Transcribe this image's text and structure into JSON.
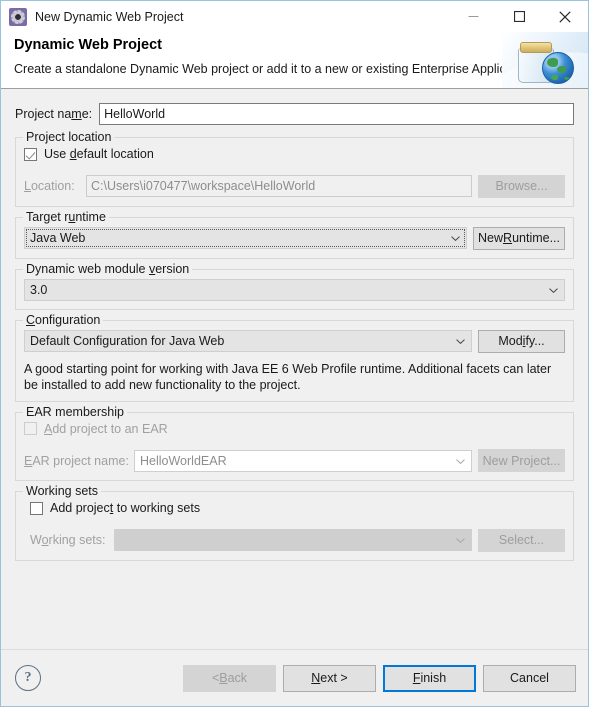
{
  "window": {
    "title": "New Dynamic Web Project",
    "icon": "eclipse-project-icon",
    "minimize_label": "—",
    "maximize_label": "□",
    "close_label": "✕"
  },
  "banner": {
    "title": "Dynamic Web Project",
    "subtitle": "Create a standalone Dynamic Web project or add it to a new or existing Enterprise Application.",
    "art": "jar-with-globe-icon"
  },
  "project_name": {
    "label": "Project name:",
    "mnemonic": "m",
    "value": "HelloWorld"
  },
  "project_location": {
    "group_title": "Project location",
    "use_default": {
      "label": "Use default location",
      "checked": true,
      "enabled": true
    },
    "location": {
      "label": "Location:",
      "value": "C:\\Users\\i070477\\workspace\\HelloWorld",
      "enabled": false
    },
    "browse_button": {
      "label": "Browse...",
      "enabled": false
    }
  },
  "target_runtime": {
    "group_title": "Target runtime",
    "selected": "Java Web",
    "focused": true,
    "new_runtime_button": "New Runtime..."
  },
  "module_version": {
    "group_title": "Dynamic web module version",
    "selected": "3.0"
  },
  "configuration": {
    "group_title": "Configuration",
    "selected": "Default Configuration for Java Web",
    "modify_button": "Modify...",
    "description": "A good starting point for working with Java EE 6 Web Profile runtime. Additional facets can later be installed to add new functionality to the project."
  },
  "ear_membership": {
    "group_title": "EAR membership",
    "add_to_ear": {
      "label": "Add project to an EAR",
      "checked": false,
      "enabled": false
    },
    "ear_project_name": {
      "label": "EAR project name:",
      "value": "HelloWorldEAR",
      "enabled": false
    },
    "new_project_button": {
      "label": "New Project...",
      "enabled": false
    }
  },
  "working_sets": {
    "group_title": "Working sets",
    "add_to_working_sets": {
      "label": "Add project to working sets",
      "checked": false,
      "enabled": true
    },
    "working_sets_combo": {
      "label": "Working sets:",
      "value": "",
      "enabled": false
    },
    "select_button": {
      "label": "Select...",
      "enabled": false
    }
  },
  "footer": {
    "help_icon": "?",
    "back_button": {
      "label": "< Back",
      "enabled": false
    },
    "next_button": {
      "label": "Next >",
      "enabled": true
    },
    "finish_button": {
      "label": "Finish",
      "enabled": true,
      "default": true
    },
    "cancel_button": {
      "label": "Cancel",
      "enabled": true
    }
  },
  "colors": {
    "window_border": "#9bc3de",
    "dialog_bg": "#f0f0f0",
    "default_button_border": "#0078d7",
    "title_icon_bg": "#7b6aa5"
  }
}
